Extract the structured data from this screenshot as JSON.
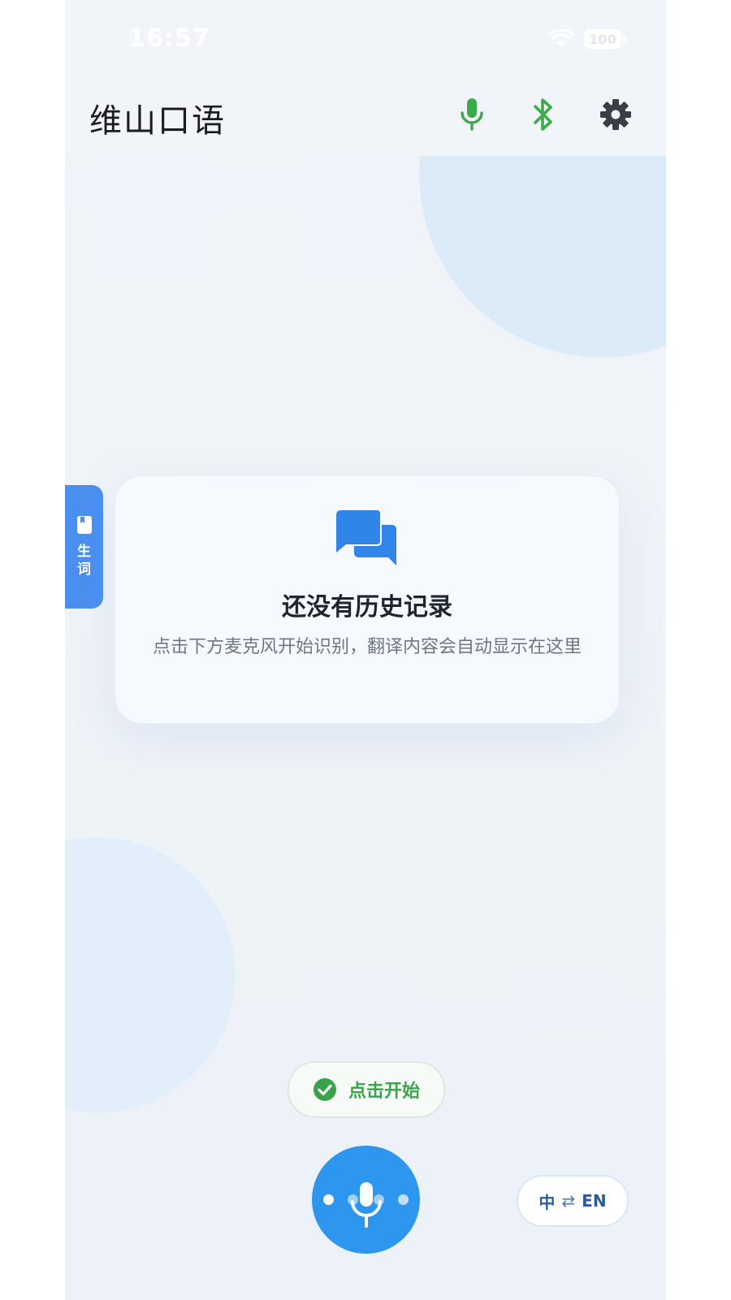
{
  "status_bar": {
    "time": "16:57",
    "battery": "100"
  },
  "header": {
    "title": "维山口语",
    "icons": [
      "mic-icon",
      "bluetooth-icon",
      "gear-icon"
    ],
    "mic_color": "#3dab4a",
    "bluetooth_color": "#3dab4a",
    "settings_color": "#3a3f47"
  },
  "side_tab": {
    "label": "生词",
    "icon": "book-icon",
    "color": "#4a8ff0"
  },
  "empty_state": {
    "icon": "chat-bubbles-icon",
    "title": "还没有历史记录",
    "description": "点击下方麦克风开始识别，翻译内容会自动显示在这里"
  },
  "controls": {
    "status_label": "点击开始",
    "status_icon": "check-circle-icon",
    "status_color": "#3aa24a",
    "mic_button_color": "#2d96ee",
    "lang_from": "中",
    "lang_to": "EN",
    "swap_glyph": "⇄"
  }
}
